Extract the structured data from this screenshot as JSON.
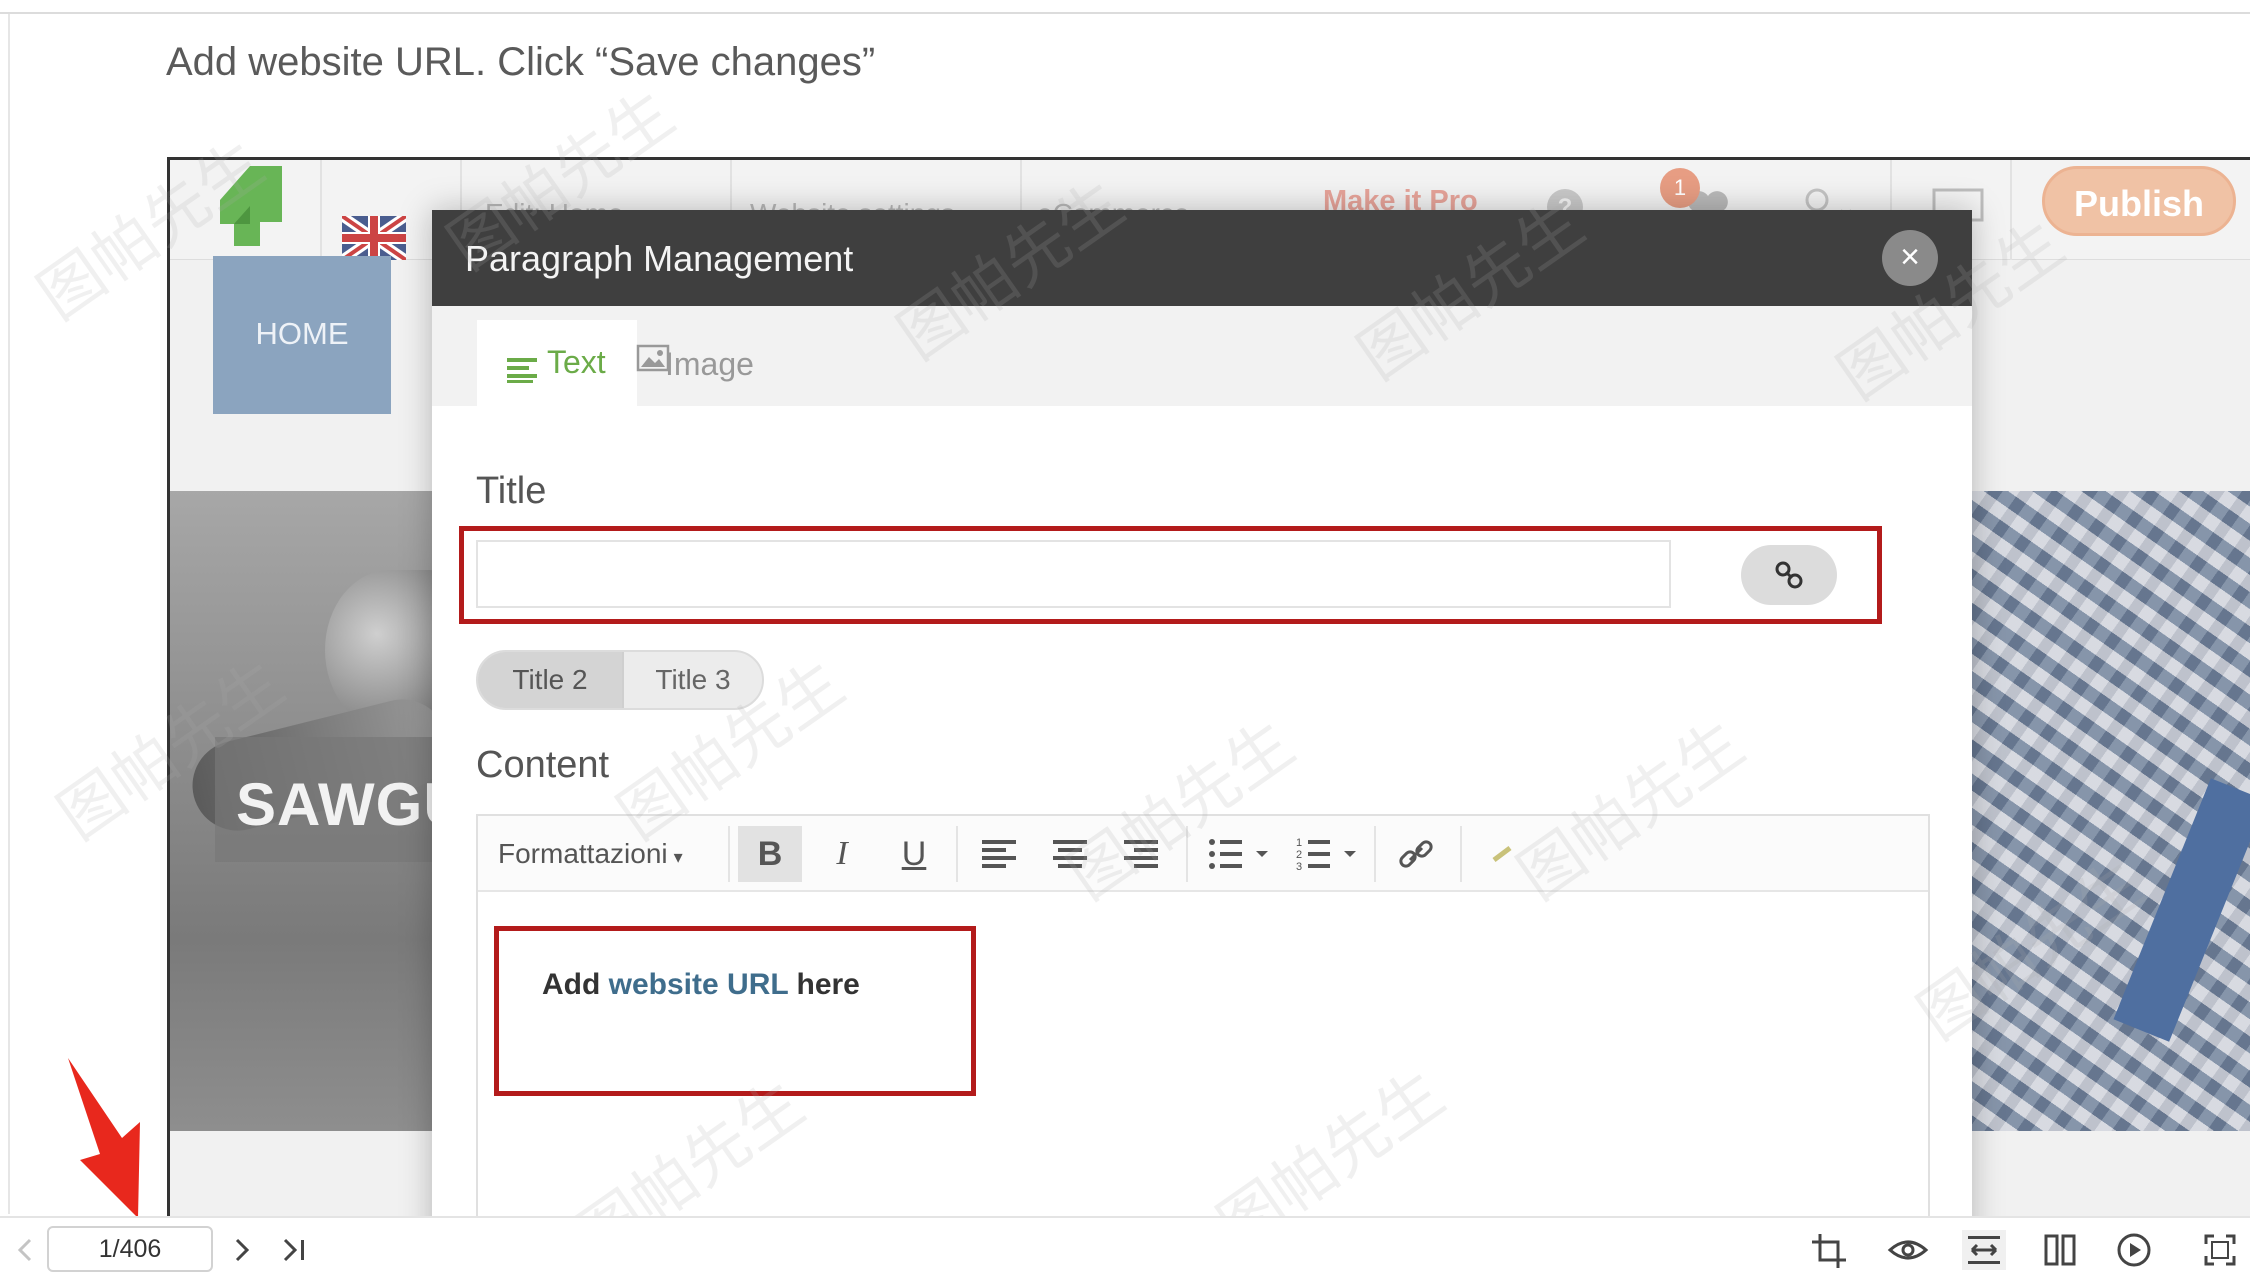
{
  "instruction": "Add website URL. Click “Save changes”",
  "site": {
    "nav_edit": "Edit: Home",
    "nav_website_settings": "Website settings",
    "nav_ecommerce": "eCommerce",
    "make_pro": "Make it Pro",
    "notif_count": "1",
    "publish": "Publish",
    "home": "HOME",
    "hero_text": "SAWGU"
  },
  "modal": {
    "title": "Paragraph Management",
    "close": "×",
    "tabs": [
      {
        "label": "Text",
        "icon": "text-lines-icon",
        "active": true
      },
      {
        "label": "Image",
        "icon": "image-icon",
        "active": false
      }
    ],
    "title_label": "Title",
    "title_value": "",
    "title_levels": [
      "Title 2",
      "Title 3"
    ],
    "content_label": "Content",
    "toolbar": {
      "format": "Formattazioni",
      "bold": "B",
      "italic": "I",
      "underline": "U"
    },
    "content": {
      "prefix": "Add ",
      "link": "website URL",
      "suffix": " here"
    }
  },
  "viewer": {
    "page_indicator": "1/406"
  },
  "colors": {
    "highlight": "#b31b1b",
    "tab_active": "#6bab48",
    "publish": "#f0c2a5",
    "modal_header": "#3f3f3f",
    "arrow": "#e8281d"
  }
}
